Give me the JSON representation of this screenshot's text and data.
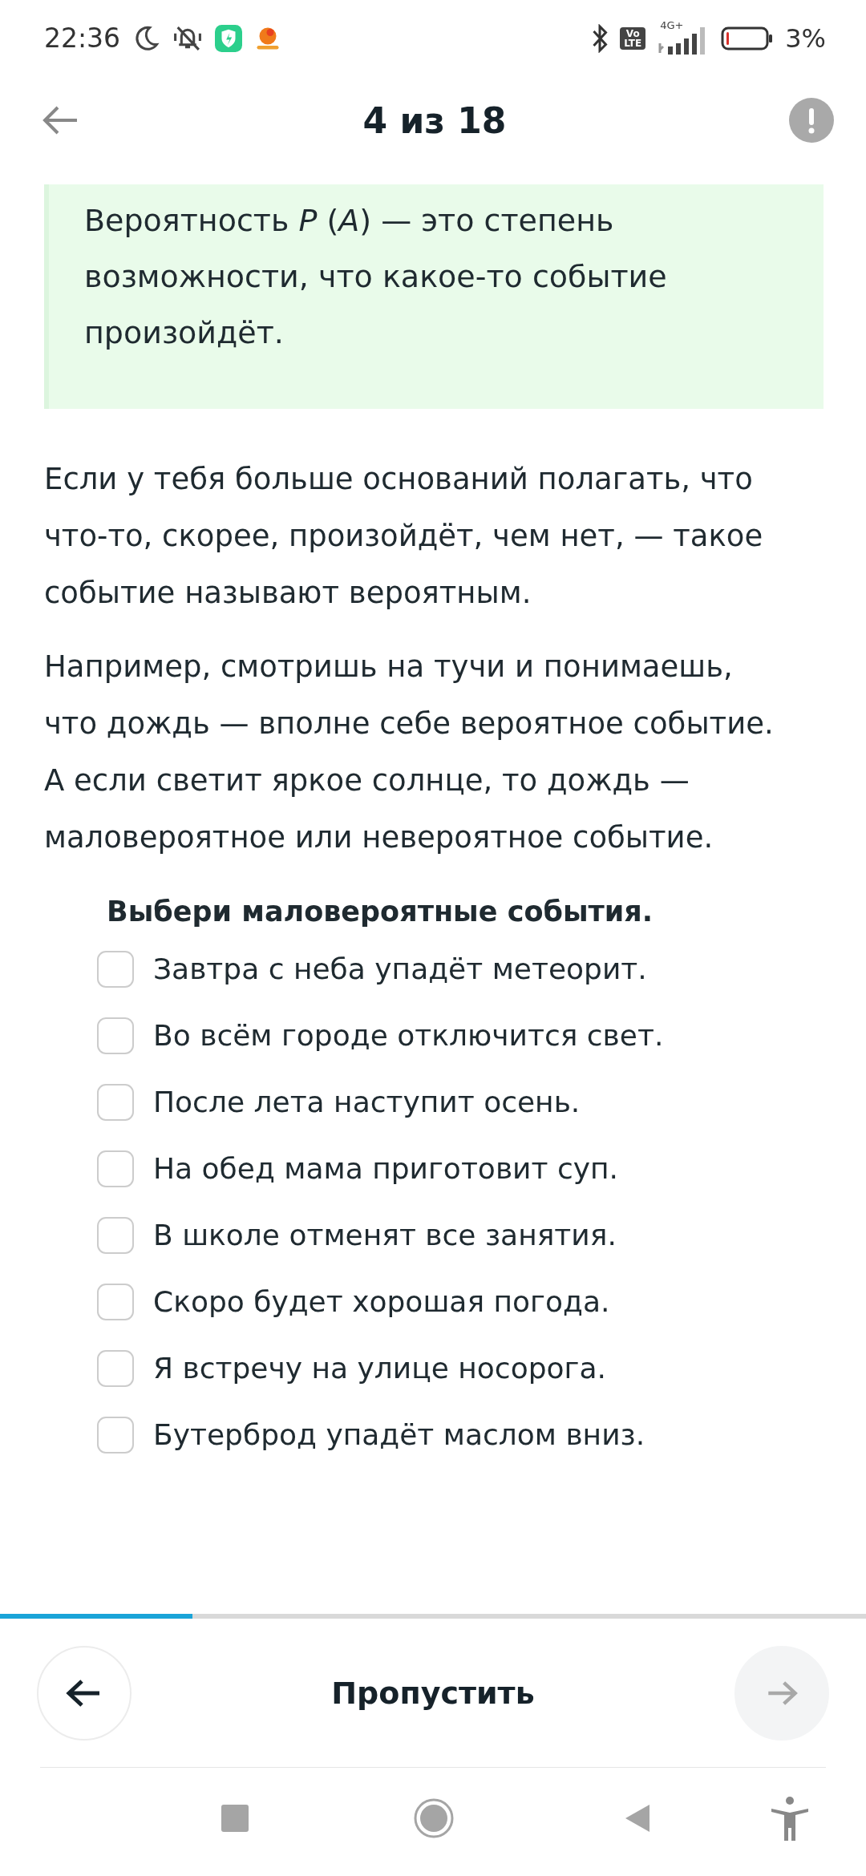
{
  "status_bar": {
    "time": "22:36",
    "volte": "Vo LTE",
    "network": "4G+",
    "battery": "3%"
  },
  "header": {
    "title": "4 из 18"
  },
  "definition": {
    "text": "Вероятность *P* (*A*) — это степень возможности, что какое-то событие произойдёт."
  },
  "paragraphs": [
    "Если у тебя больше оснований полагать, что что-то, скорее, произойдёт, чем нет, — такое событие называют вероятным.",
    "Например, смотришь на тучи и понимаешь, что дождь — вполне себе вероятное событие. А если светит яркое солнце, то дождь — маловероятное или невероятное событие."
  ],
  "question": {
    "title": "Выбери маловероятные события.",
    "options": [
      {
        "label": "Завтра с неба упадёт метеорит.",
        "checked": false
      },
      {
        "label": "Во всём городе отключится свет.",
        "checked": false
      },
      {
        "label": "После лета наступит осень.",
        "checked": false
      },
      {
        "label": "На обед мама приготовит суп.",
        "checked": false
      },
      {
        "label": "В школе отменят все занятия.",
        "checked": false
      },
      {
        "label": "Скоро будет хорошая погода.",
        "checked": false
      },
      {
        "label": "Я встречу на улице носорога.",
        "checked": false
      },
      {
        "label": "Бутерброд упадёт маслом вниз.",
        "checked": false
      }
    ]
  },
  "progress": {
    "level": 0.222
  },
  "footer": {
    "skip_label": "Пропустить",
    "next_disabled": true
  }
}
